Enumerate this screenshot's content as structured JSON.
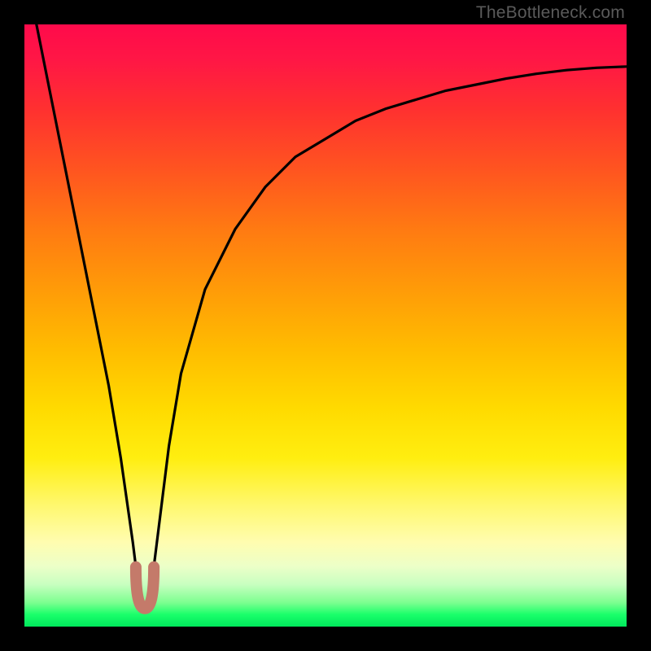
{
  "watermark": "TheBottleneck.com",
  "colors": {
    "frame": "#000000",
    "curve": "#000000",
    "marker": "#c47a6a",
    "gradient_top": "#ff0a4b",
    "gradient_bottom": "#00e85c"
  },
  "chart_data": {
    "type": "line",
    "title": "",
    "xlabel": "",
    "ylabel": "",
    "xlim": [
      0,
      100
    ],
    "ylim": [
      0,
      100
    ],
    "note": "Axes unlabeled in source image; values below are visual positions (percent of plot area, y measured from bottom).",
    "series": [
      {
        "name": "bottleneck-curve",
        "x": [
          2,
          4,
          6,
          8,
          10,
          12,
          14,
          16,
          18,
          19,
          20,
          21,
          22,
          24,
          26,
          30,
          35,
          40,
          45,
          50,
          55,
          60,
          65,
          70,
          75,
          80,
          85,
          90,
          95,
          100
        ],
        "y": [
          100,
          90,
          80,
          70,
          60,
          50,
          40,
          28,
          14,
          6,
          3,
          6,
          14,
          30,
          42,
          56,
          66,
          73,
          78,
          81,
          84,
          86,
          87.5,
          89,
          90,
          91,
          91.8,
          92.4,
          92.8,
          93
        ]
      }
    ],
    "markers": [
      {
        "name": "dip-marker-left",
        "x": 18.5,
        "y": 8
      },
      {
        "name": "dip-marker-bottom",
        "x": 20,
        "y": 3
      },
      {
        "name": "dip-marker-right",
        "x": 21.5,
        "y": 8
      }
    ]
  }
}
